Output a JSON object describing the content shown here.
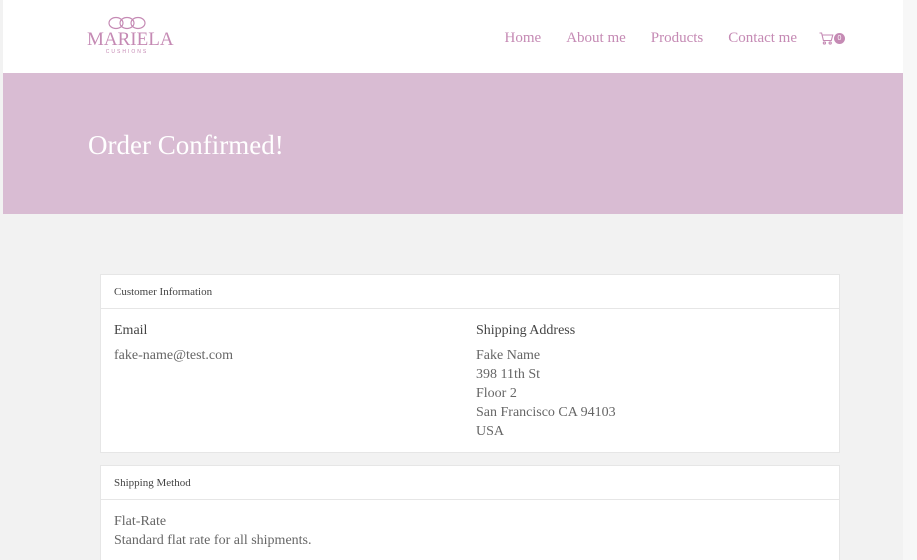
{
  "brand": {
    "name": "MARIELA",
    "tagline": "CUSHIONS"
  },
  "nav": {
    "items": [
      {
        "label": "Home"
      },
      {
        "label": "About me"
      },
      {
        "label": "Products"
      },
      {
        "label": "Contact me"
      }
    ],
    "cart_count": "0"
  },
  "banner": {
    "title": "Order Confirmed!"
  },
  "customer_info": {
    "heading": "Customer Information",
    "email_label": "Email",
    "email": "fake-name@test.com",
    "address_label": "Shipping Address",
    "address_lines": [
      "Fake Name",
      "398 11th St",
      "Floor 2",
      "San Francisco CA 94103",
      "USA"
    ]
  },
  "shipping_method": {
    "heading": "Shipping Method",
    "name": "Flat-Rate",
    "description": "Standard flat rate for all shipments."
  },
  "colors": {
    "accent": "#c58ab4",
    "banner": "#d9bcd3",
    "page_bg": "#f2f2f2"
  }
}
